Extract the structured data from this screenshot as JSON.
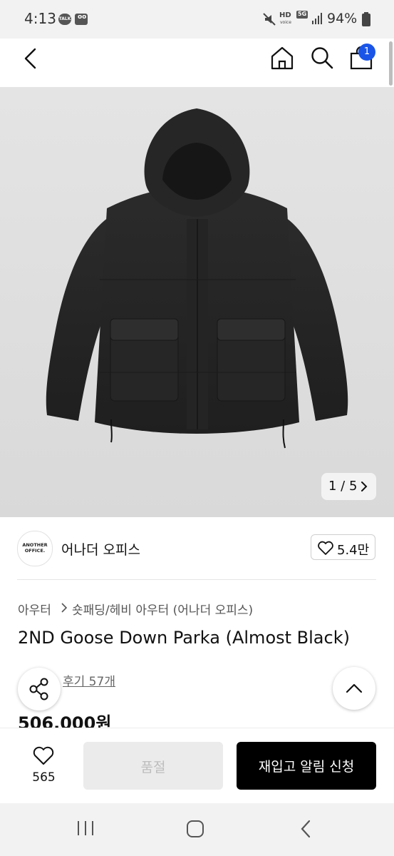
{
  "status_bar": {
    "time": "4:13",
    "notif_1": "TALK",
    "notif_2": "oo",
    "network_hd": "HD",
    "network_sub": "voice",
    "network_5g": "5G",
    "battery": "94%"
  },
  "header": {
    "back_icon": "chevron-left-icon",
    "home_icon": "home-icon",
    "search_icon": "search-icon",
    "cart_icon": "shopping-bag-icon",
    "cart_count": "1"
  },
  "gallery": {
    "counter": "1 / 5",
    "next_icon": "chevron-right-icon"
  },
  "brand": {
    "logo_line1": "ANOTHER",
    "logo_line2": "OFFICE.",
    "name": "어나더 오피스",
    "like_count": "5.4만"
  },
  "product": {
    "category_main": "아우터",
    "category_sub": "숏패딩/헤비 아우터 (어나더 오피스)",
    "title": "2ND Goose Down Parka (Almost Black)",
    "review": "후기 57개",
    "price": "506,000원"
  },
  "bottom_bar": {
    "wishlist_count": "565",
    "soldout_label": "품절",
    "restock_label": "재입고 알림 신청"
  },
  "colors": {
    "accent": "#1a55e8",
    "cta": "#000000",
    "disabled": "#ebebeb"
  }
}
